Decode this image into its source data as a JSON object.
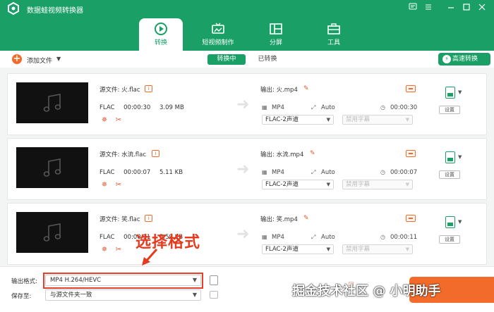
{
  "app": {
    "title": "数据蛙视频转换器",
    "window_controls": [
      "feedback-icon",
      "menu-icon",
      "minimize-icon",
      "maximize-icon",
      "close-icon"
    ]
  },
  "tabs": [
    {
      "label": "转换",
      "icon": "convert-icon",
      "active": true
    },
    {
      "label": "短视频制作",
      "icon": "tv-icon",
      "active": false
    },
    {
      "label": "分屏",
      "icon": "split-screen-icon",
      "active": false
    },
    {
      "label": "工具",
      "icon": "toolbox-icon",
      "active": false
    }
  ],
  "toolbar": {
    "add_file": "添加文件",
    "seg_converting": "转换中",
    "seg_converted": "已转换",
    "fast_convert": "高速转换"
  },
  "files": [
    {
      "source": "源文件: 火.flac",
      "format": "FLAC",
      "duration": "00:00:30",
      "size": "3.09 MB",
      "output": "输出: 火.mp4",
      "out_format": "MP4",
      "resolution": "Auto",
      "out_duration": "00:00:30",
      "audio": "FLAC-2声道",
      "subtitle": "禁用字幕",
      "settings": "设置"
    },
    {
      "source": "源文件: 水流.flac",
      "format": "FLAC",
      "duration": "00:00:07",
      "size": "5.11 KB",
      "output": "输出: 水流.mp4",
      "out_format": "MP4",
      "resolution": "Auto",
      "out_duration": "00:00:07",
      "audio": "FLAC-2声道",
      "subtitle": "禁用字幕",
      "settings": "设置"
    },
    {
      "source": "源文件: 笑.flac",
      "format": "FLAC",
      "duration": "00:00:11",
      "size": "5.59 KB",
      "output": "输出: 笑.mp4",
      "out_format": "MP4",
      "resolution": "Auto",
      "out_duration": "00:00:11",
      "audio": "FLAC-2声道",
      "subtitle": "禁用字幕",
      "settings": "设置"
    }
  ],
  "bottom": {
    "output_format_label": "输出格式:",
    "output_format_value": "MP4 H.264/HEVC",
    "save_to_label": "保存至:",
    "save_to_value": "与源文件夹一致"
  },
  "annotation": {
    "text": "选择格式"
  },
  "watermark": "掘金技术社区 @ 小明助手",
  "colors": {
    "brand_green": "#1aa066",
    "accent_orange": "#f26b2a",
    "annotation_red": "#e8402a"
  }
}
